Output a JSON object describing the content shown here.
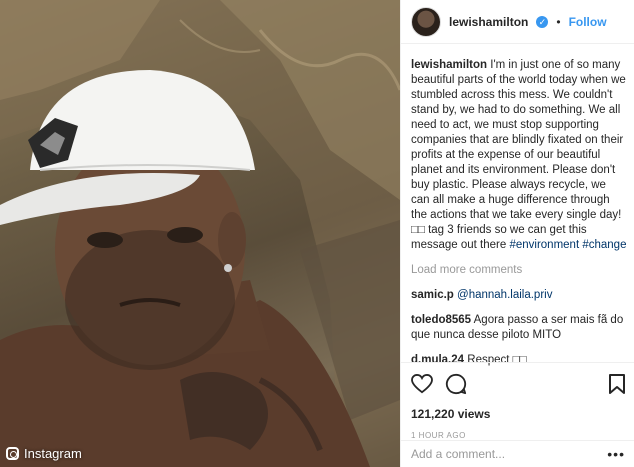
{
  "media": {
    "watermark": "Instagram",
    "watermark_icon": "instagram-icon"
  },
  "header": {
    "username": "lewishamilton",
    "verified_icon": "verified-badge-icon",
    "separator": "•",
    "follow_label": "Follow"
  },
  "caption": {
    "username": "lewishamilton",
    "text": "I'm in just one of so many beautiful parts of the world today when we stumbled across this mess. We couldn't stand by, we had to do something. We all need to act, we must stop supporting companies that are blindly fixated on their profits at the expense of our beautiful planet and its environment. Please don't buy plastic. Please always recycle, we can all make a huge difference through the actions that we take every single day! □□ tag 3 friends so we can get this message out there ",
    "hashtags": [
      "#environment",
      "#change"
    ]
  },
  "load_more": "Load more comments",
  "comments": [
    {
      "username": "samic.p",
      "text": "",
      "mention": "@hannah.laila.priv"
    },
    {
      "username": "toledo8565",
      "text": "Agora passo a ser mais fã do que nunca desse piloto MITO",
      "mention": ""
    },
    {
      "username": "d.mula.24",
      "text": "Respect □□",
      "mention": ""
    }
  ],
  "actions": {
    "like_icon": "heart-icon",
    "comment_icon": "comment-icon",
    "save_icon": "bookmark-icon"
  },
  "views": "121,220 views",
  "timestamp": "1 HOUR AGO",
  "add_comment": {
    "placeholder": "Add a comment...",
    "more_icon": "more-options-icon"
  }
}
